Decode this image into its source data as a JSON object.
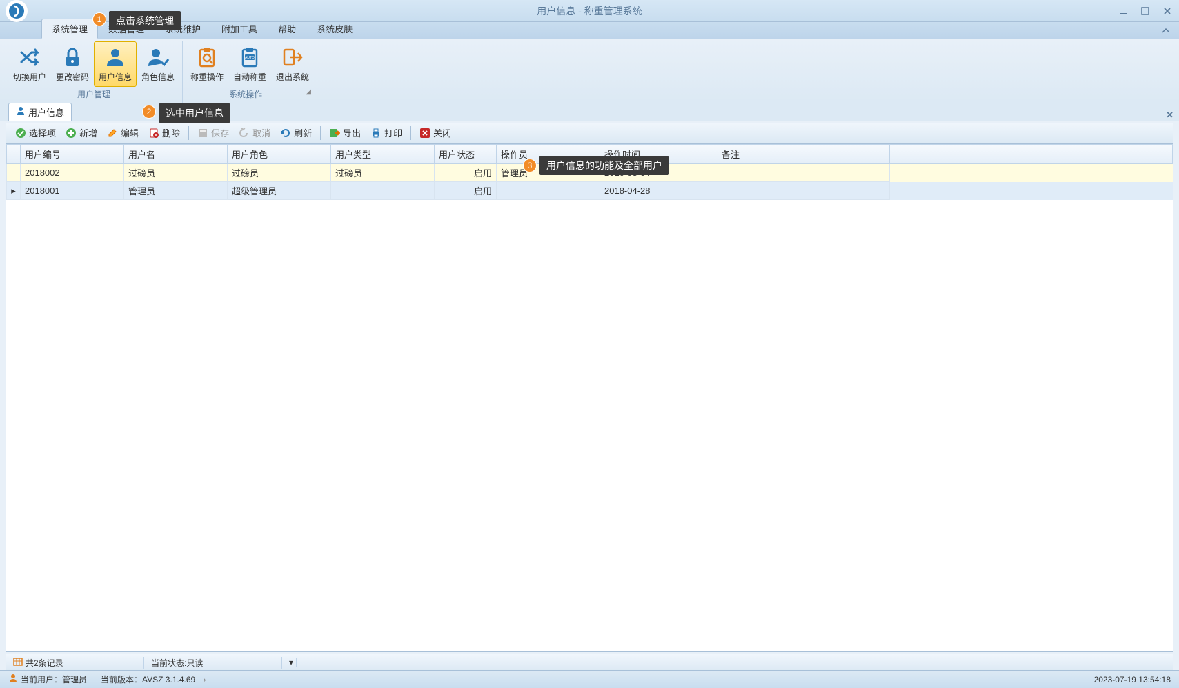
{
  "window": {
    "title": "用户信息 - 称重管理系统"
  },
  "menu": {
    "tabs": [
      "系统管理",
      "数据管理",
      "系统维护",
      "附加工具",
      "帮助",
      "系统皮肤"
    ]
  },
  "ribbon": {
    "groups": [
      {
        "label": "用户管理",
        "items": [
          {
            "name": "switch-user",
            "label": "切换用户",
            "icon": "shuffle",
            "color": "#2a7ab8"
          },
          {
            "name": "change-password",
            "label": "更改密码",
            "icon": "lock",
            "color": "#2a7ab8"
          },
          {
            "name": "user-info",
            "label": "用户信息",
            "icon": "user",
            "color": "#2a7ab8",
            "active": true
          },
          {
            "name": "role-info",
            "label": "角色信息",
            "icon": "user-check",
            "color": "#2a7ab8"
          }
        ]
      },
      {
        "label": "系统操作",
        "items": [
          {
            "name": "weigh-op",
            "label": "称重操作",
            "icon": "scan",
            "color": "#e08020"
          },
          {
            "name": "auto-weigh",
            "label": "自动称重",
            "icon": "auto",
            "color": "#2a7ab8"
          },
          {
            "name": "exit-system",
            "label": "退出系统",
            "icon": "exit",
            "color": "#e08020"
          }
        ]
      }
    ]
  },
  "panel": {
    "tab_label": "用户信息"
  },
  "toolbar": {
    "select": "选择项",
    "add": "新增",
    "edit": "编辑",
    "delete": "删除",
    "save": "保存",
    "cancel": "取消",
    "refresh": "刷新",
    "export": "导出",
    "print": "打印",
    "close": "关闭"
  },
  "grid": {
    "columns": [
      "用户编号",
      "用户名",
      "用户角色",
      "用户类型",
      "用户状态",
      "操作员",
      "操作时间",
      "备注"
    ],
    "rows": [
      {
        "id": "2018002",
        "name": "过磅员",
        "role": "过磅员",
        "type": "过磅员",
        "status": "启用",
        "operator": "管理员",
        "time": "2020-03-04",
        "remark": "",
        "highlight": true
      },
      {
        "id": "2018001",
        "name": "管理员",
        "role": "超级管理员",
        "type": "",
        "status": "启用",
        "operator": "",
        "time": "2018-04-28",
        "remark": "",
        "selected": true
      }
    ]
  },
  "status": {
    "records": "共2条记录",
    "state": "当前状态:只读"
  },
  "footer": {
    "user": "当前用户：管理员",
    "version": "当前版本：AVSZ 3.1.4.69",
    "datetime": "2023-07-19 13:54:18"
  },
  "callouts": {
    "c1": "点击系统管理",
    "c2": "选中用户信息",
    "c3": "用户信息的功能及全部用户"
  }
}
